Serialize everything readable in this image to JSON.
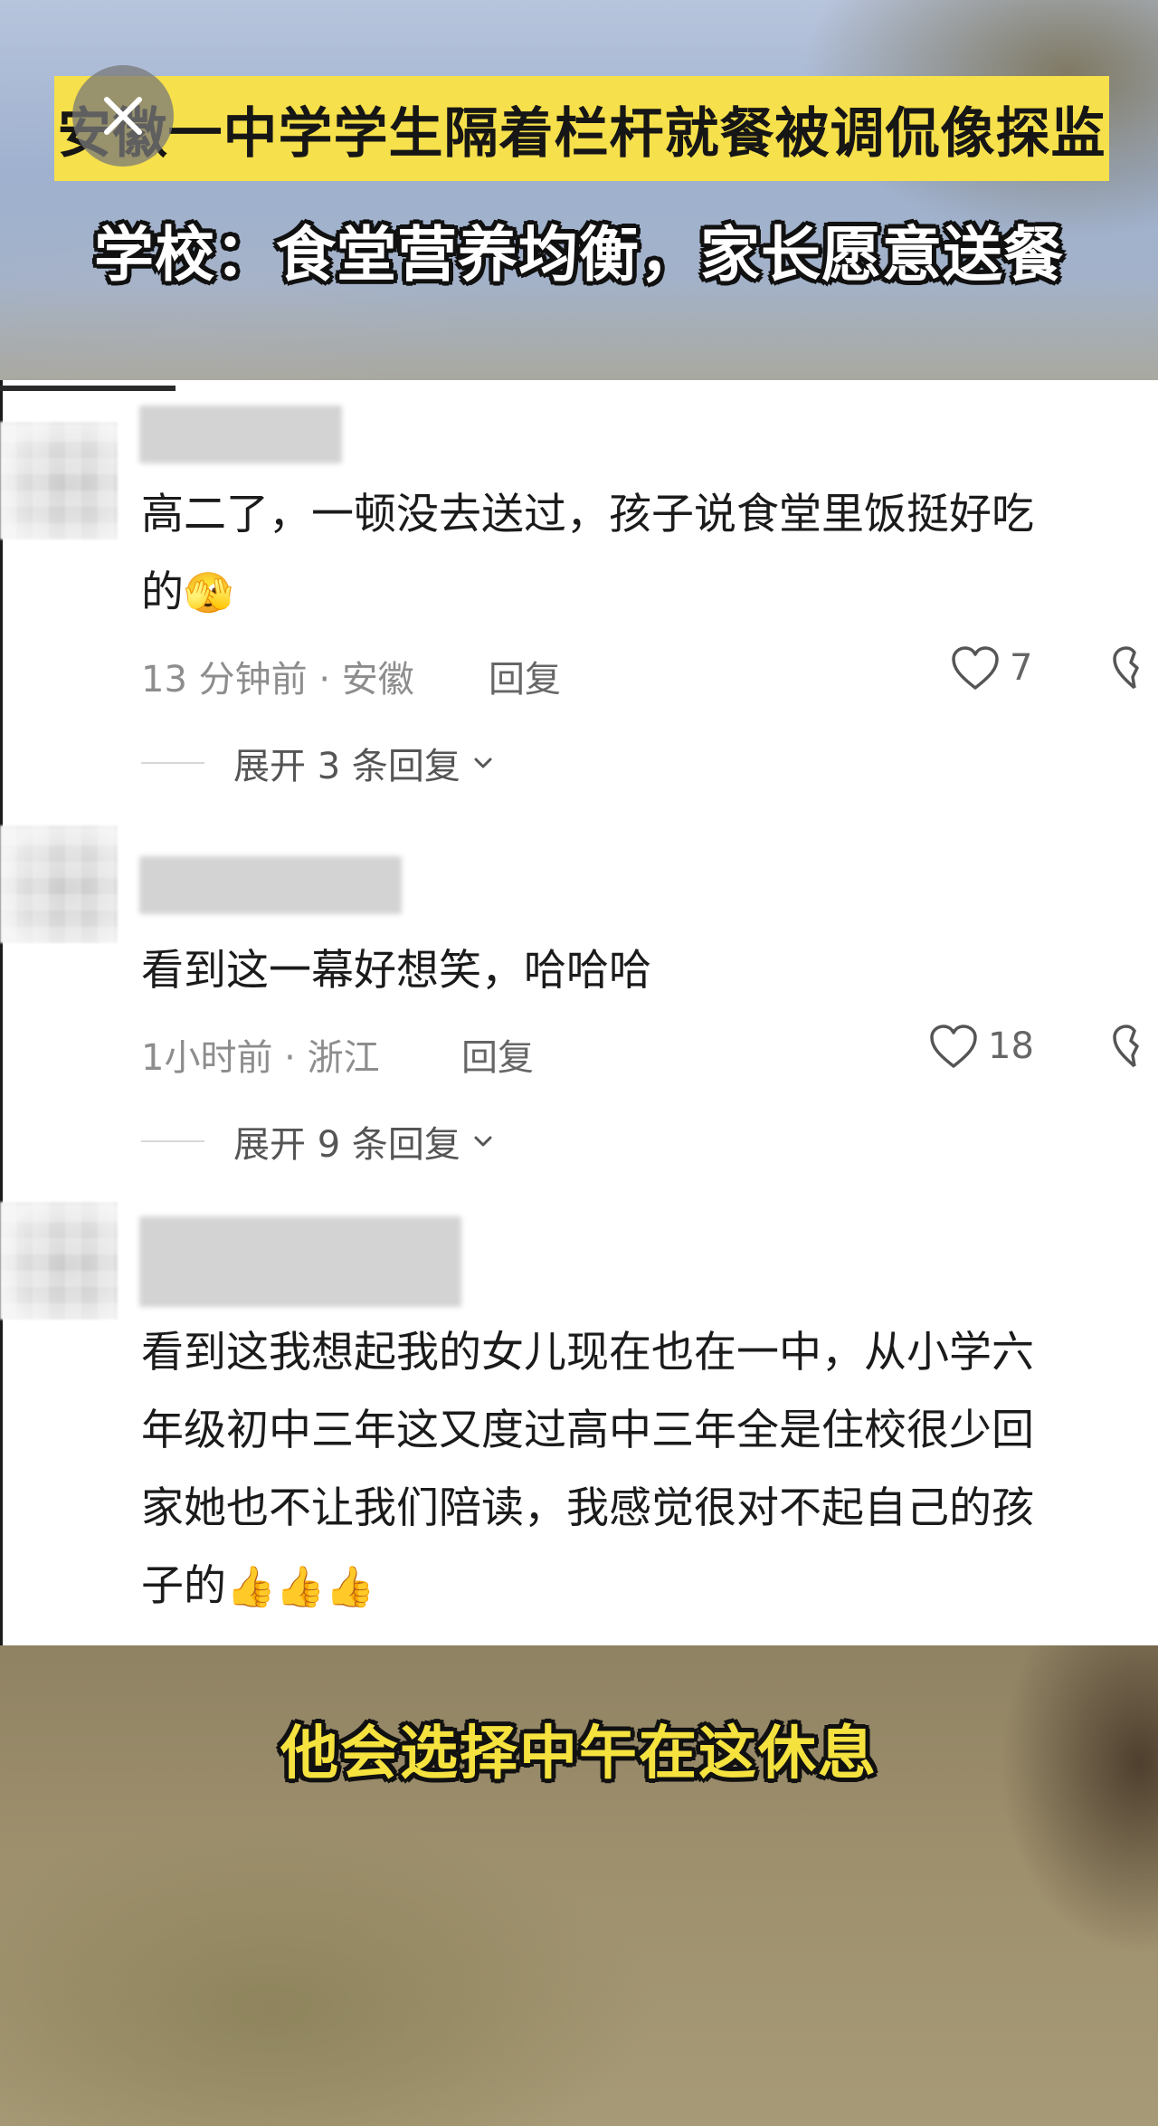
{
  "video": {
    "headline": "安徽一中学学生隔着栏杆就餐被调侃像探监",
    "subheadline": "学校：食堂营养均衡，家长愿意送餐",
    "caption": "他会选择中午在这休息"
  },
  "icons": {
    "close": "close-icon",
    "like": "heart-outline-icon",
    "dislike": "broken-heart-icon",
    "expand": "chevron-down-icon"
  },
  "comments": [
    {
      "text_line1": "高二了，一顿没去送过，孩子说食堂里饭挺好吃",
      "text_line2": "的",
      "emoji": "🫣",
      "meta": "13 分钟前 · 安徽",
      "reply": "回复",
      "likes": "7",
      "expand": "展开 3 条回复"
    },
    {
      "text_line1": "看到这一幕好想笑，哈哈哈",
      "meta": "1小时前 · 浙江",
      "reply": "回复",
      "likes": "18",
      "expand": "展开 9 条回复"
    },
    {
      "text_line1": "看到这我想起我的女儿现在也在一中，从小学六",
      "text_line2": "年级初中三年这又度过高中三年全是住校很少回",
      "text_line3": "家她也不让我们陪读，我感觉很对不起自己的孩",
      "text_line4": "子的",
      "emoji": "👍👍👍"
    }
  ]
}
